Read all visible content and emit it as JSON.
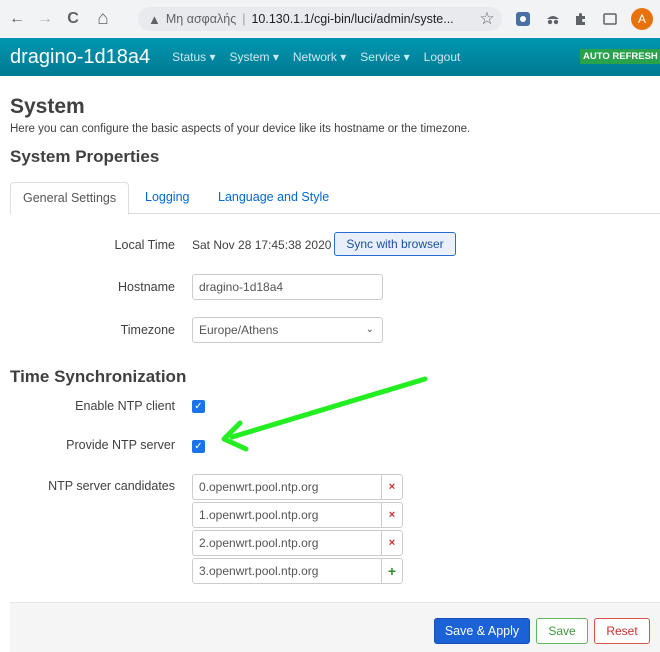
{
  "browser": {
    "back_icon": "←",
    "forward_icon": "→",
    "reload_icon": "C",
    "home_icon": "⌂",
    "warning_icon": "▲",
    "security_label": "Μη ασφαλής",
    "separator": "|",
    "url": "10.130.1.1/cgi-bin/luci/admin/syste...",
    "star_icon": "☆",
    "profile_initial": "A"
  },
  "header": {
    "brand": "dragino-1d18a4",
    "menu": [
      "Status ▾",
      "System ▾",
      "Network ▾",
      "Service ▾",
      "Logout"
    ],
    "auto_refresh": "AUTO REFRESH O"
  },
  "page": {
    "title": "System",
    "description": "Here you can configure the basic aspects of your device like its hostname or the timezone.",
    "properties_title": "System Properties",
    "tabs": [
      "General Settings",
      "Logging",
      "Language and Style"
    ],
    "active_tab": "General Settings"
  },
  "general": {
    "local_time_label": "Local Time",
    "local_time_value": "Sat Nov 28 17:45:38 2020",
    "sync_button": "Sync with browser",
    "hostname_label": "Hostname",
    "hostname_value": "dragino-1d18a4",
    "timezone_label": "Timezone",
    "timezone_value": "Europe/Athens"
  },
  "ntp": {
    "title": "Time Synchronization",
    "enable_client_label": "Enable NTP client",
    "enable_client_checked": true,
    "provide_server_label": "Provide NTP server",
    "provide_server_checked": true,
    "candidates_label": "NTP server candidates",
    "candidates": [
      "0.openwrt.pool.ntp.org",
      "1.openwrt.pool.ntp.org",
      "2.openwrt.pool.ntp.org",
      "3.openwrt.pool.ntp.org"
    ],
    "remove_icon": "×",
    "add_icon": "+",
    "check_icon": "✓"
  },
  "footer": {
    "save_apply": "Save & Apply",
    "save": "Save",
    "reset": "Reset"
  },
  "colors": {
    "header": "#0089a3",
    "annotation_arrow": "#22ee22",
    "primary": "#1a62d6"
  }
}
